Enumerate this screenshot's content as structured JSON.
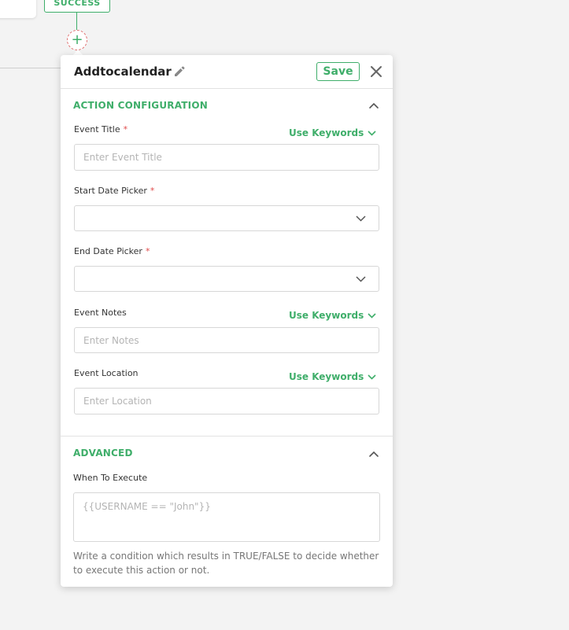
{
  "canvas": {
    "success_label": "SUCCESS",
    "add_symbol": "+"
  },
  "panel": {
    "title": "Addtocalendar",
    "save_label": "Save",
    "action_section": {
      "title": "ACTION CONFIGURATION",
      "fields": {
        "event_title": {
          "label": "Event Title",
          "required_mark": "*",
          "placeholder": "Enter Event Title",
          "keywords_label": "Use Keywords"
        },
        "start_date": {
          "label": "Start Date Picker",
          "required_mark": "*",
          "value": ""
        },
        "end_date": {
          "label": "End Date Picker",
          "required_mark": "*",
          "value": ""
        },
        "event_notes": {
          "label": "Event Notes",
          "placeholder": "Enter Notes",
          "keywords_label": "Use Keywords"
        },
        "event_location": {
          "label": "Event Location",
          "placeholder": "Enter Location",
          "keywords_label": "Use Keywords"
        }
      }
    },
    "advanced_section": {
      "title": "ADVANCED",
      "when_label": "When To Execute",
      "when_placeholder": "{{USERNAME == \"John\"}}",
      "help_text": "Write a condition which results in TRUE/FALSE to decide whether to execute this action or not."
    }
  },
  "colors": {
    "accent": "#3fae6a",
    "required": "#e04a4a",
    "background": "#f3f3f3"
  },
  "icons": {
    "edit": "pencil-icon",
    "close": "close-icon",
    "collapse": "chevron-up-icon",
    "dropdown": "chevron-down-icon",
    "add": "plus-icon"
  }
}
